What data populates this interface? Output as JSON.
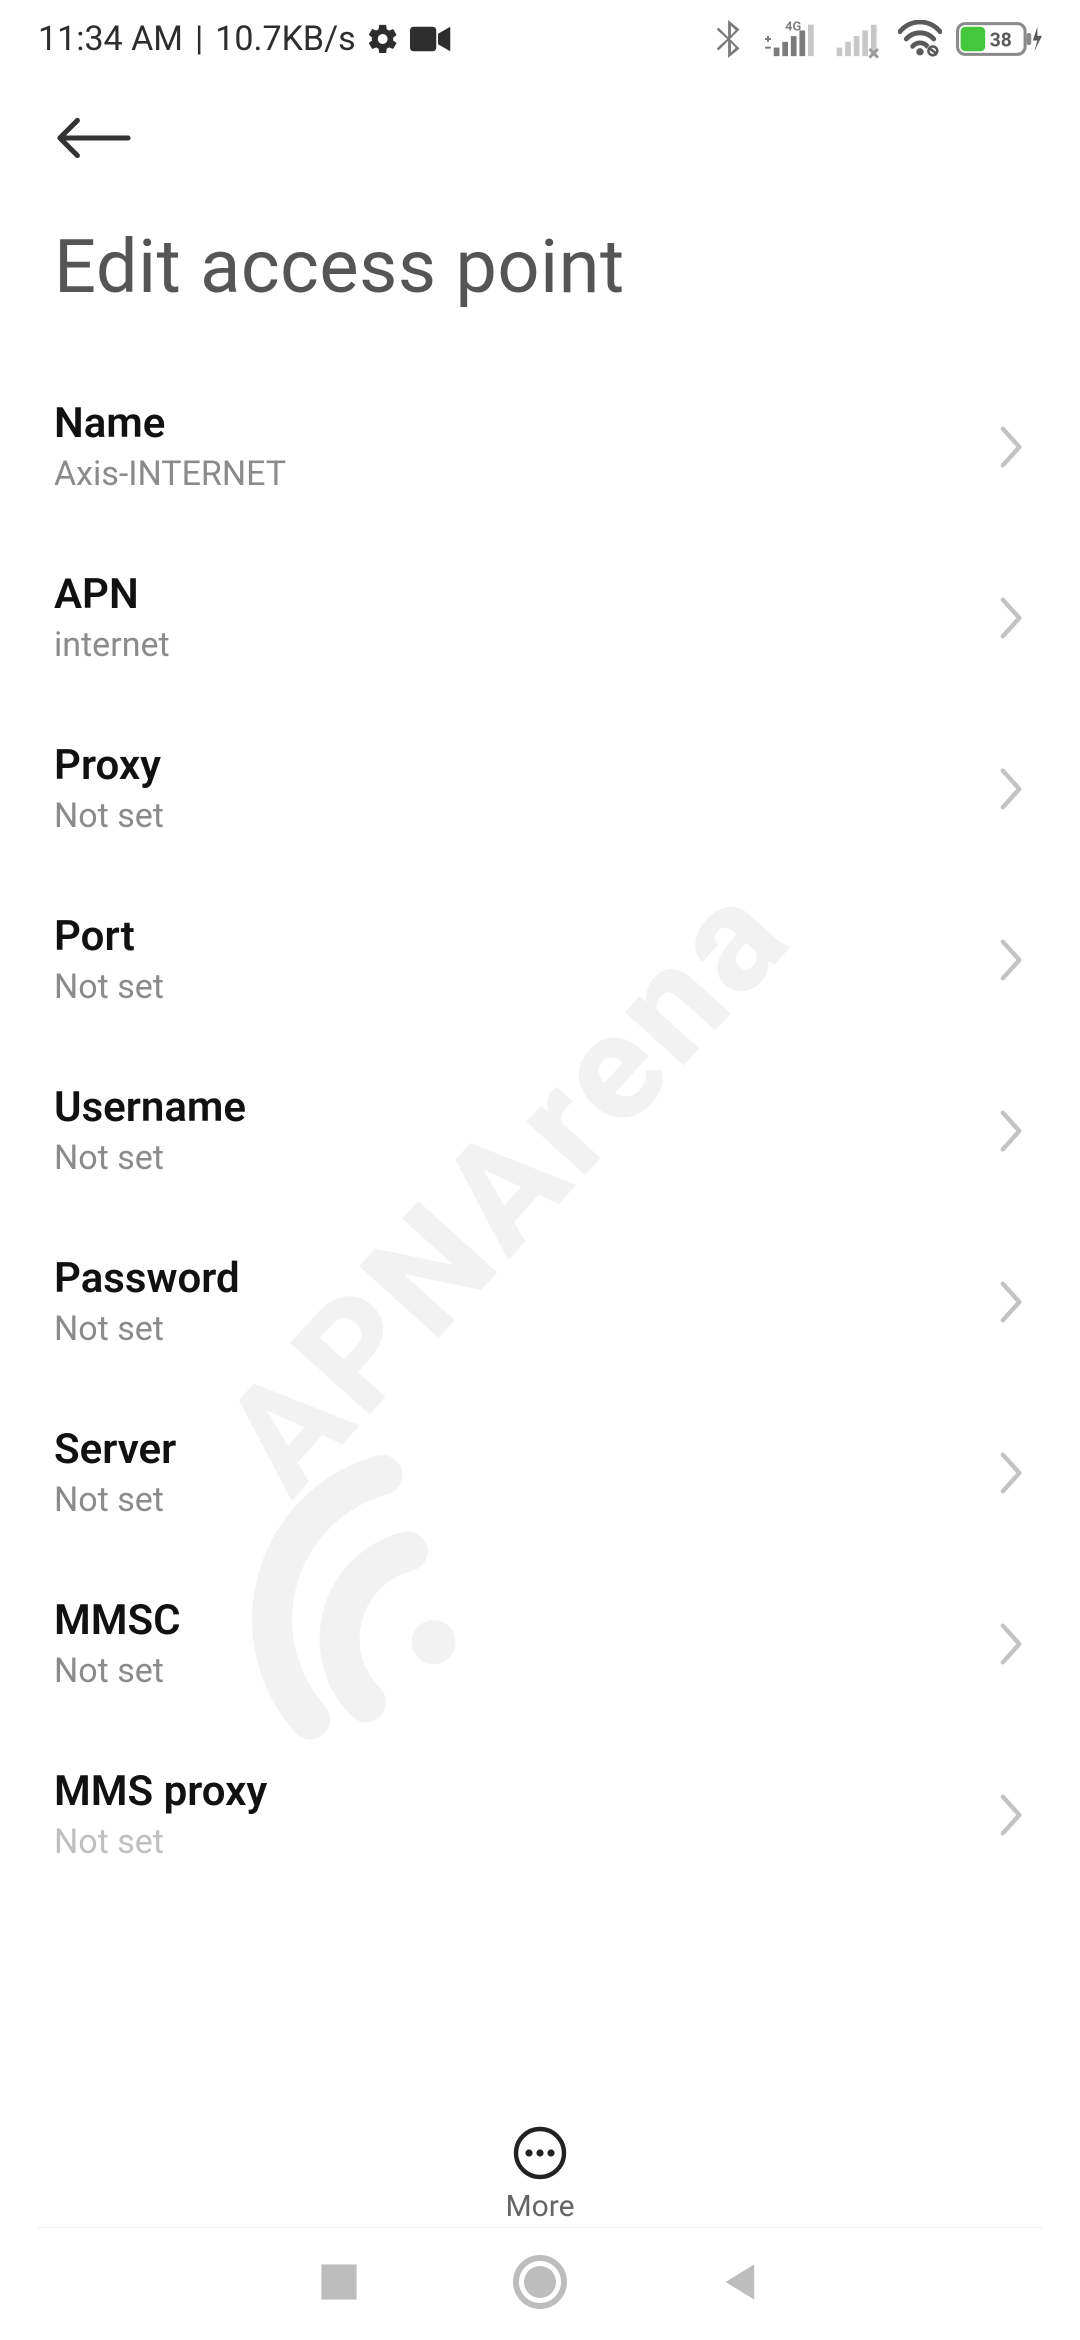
{
  "status": {
    "time": "11:34 AM",
    "speed": "10.7KB/s",
    "network_label": "4G",
    "battery_percent": "38"
  },
  "header": {
    "title": "Edit access point"
  },
  "rows": [
    {
      "label": "Name",
      "value": "Axis-INTERNET"
    },
    {
      "label": "APN",
      "value": "internet"
    },
    {
      "label": "Proxy",
      "value": "Not set"
    },
    {
      "label": "Port",
      "value": "Not set"
    },
    {
      "label": "Username",
      "value": "Not set"
    },
    {
      "label": "Password",
      "value": "Not set"
    },
    {
      "label": "Server",
      "value": "Not set"
    },
    {
      "label": "MMSC",
      "value": "Not set"
    },
    {
      "label": "MMS proxy",
      "value": "Not set"
    }
  ],
  "more_label": "More",
  "watermark": "APNArena"
}
